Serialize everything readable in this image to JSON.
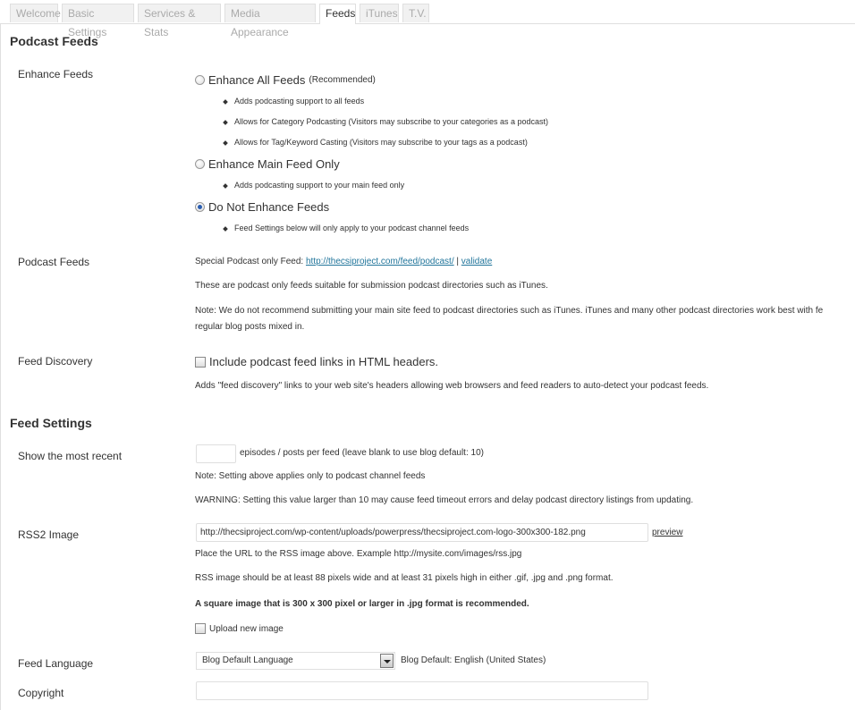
{
  "tabs": [
    {
      "label": "Welcome",
      "active": false
    },
    {
      "label": "Basic Settings",
      "active": false
    },
    {
      "label": "Services & Stats",
      "active": false
    },
    {
      "label": "Media Appearance",
      "active": false
    },
    {
      "label": "Feeds",
      "active": true
    },
    {
      "label": "iTunes",
      "active": false
    },
    {
      "label": "T.V.",
      "active": false
    }
  ],
  "podcast_feeds_section": {
    "heading": "Podcast Feeds",
    "enhance_feeds": {
      "label": "Enhance Feeds",
      "options": [
        {
          "label": "Enhance All Feeds",
          "note": "(Recommended)",
          "checked": false,
          "bullets": [
            "Adds podcasting support to all feeds",
            "Allows for Category Podcasting (Visitors may subscribe to your categories as a podcast)",
            "Allows for Tag/Keyword Casting (Visitors may subscribe to your tags as a podcast)"
          ]
        },
        {
          "label": "Enhance Main Feed Only",
          "checked": false,
          "bullets": [
            "Adds podcasting support to your main feed only"
          ]
        },
        {
          "label": "Do Not Enhance Feeds",
          "checked": true,
          "bullets": [
            "Feed Settings below will only apply to your podcast channel feeds"
          ]
        }
      ]
    },
    "podcast_feeds": {
      "label": "Podcast Feeds",
      "special_prefix": "Special Podcast only Feed:",
      "feed_link": "http://thecsiproject.com/feed/podcast/",
      "separator": "|",
      "validate_link": "validate",
      "description": "These are podcast only feeds suitable for submission podcast directories such as iTunes.",
      "note_line1": "Note: We do not recommend submitting your main site feed to podcast directories such as iTunes. iTunes and many other podcast directories work best with fe",
      "note_line2": "regular blog posts mixed in."
    },
    "feed_discovery": {
      "label": "Feed Discovery",
      "checkbox_label": "Include podcast feed links in HTML headers.",
      "checked": false,
      "description": "Adds \"feed discovery\" links to your web site's headers allowing web browsers and feed readers to auto-detect your podcast feeds."
    }
  },
  "feed_settings_section": {
    "heading": "Feed Settings",
    "show_most_recent": {
      "label": "Show the most recent",
      "value": "",
      "suffix": "episodes / posts per feed (leave blank to use blog default: 10)",
      "note": "Note: Setting above applies only to podcast channel feeds",
      "warning": "WARNING: Setting this value larger than 10 may cause feed timeout errors and delay podcast directory listings from updating."
    },
    "rss2_image": {
      "label": "RSS2 Image",
      "value": "http://thecsiproject.com/wp-content/uploads/powerpress/thecsiproject.com-logo-300x300-182.png",
      "preview_link": "preview",
      "help1": "Place the URL to the RSS image above. Example http://mysite.com/images/rss.jpg",
      "help2": "RSS image should be at least 88 pixels wide and at least 31 pixels high in either .gif, .jpg and .png format.",
      "recommendation": "A square image that is 300 x 300 pixel or larger in .jpg format is recommended.",
      "upload_label": "Upload new image",
      "upload_checked": false
    },
    "feed_language": {
      "label": "Feed Language",
      "selected": "Blog Default Language",
      "default_note": "Blog Default: English (United States)"
    },
    "copyright": {
      "label": "Copyright",
      "value": ""
    }
  }
}
